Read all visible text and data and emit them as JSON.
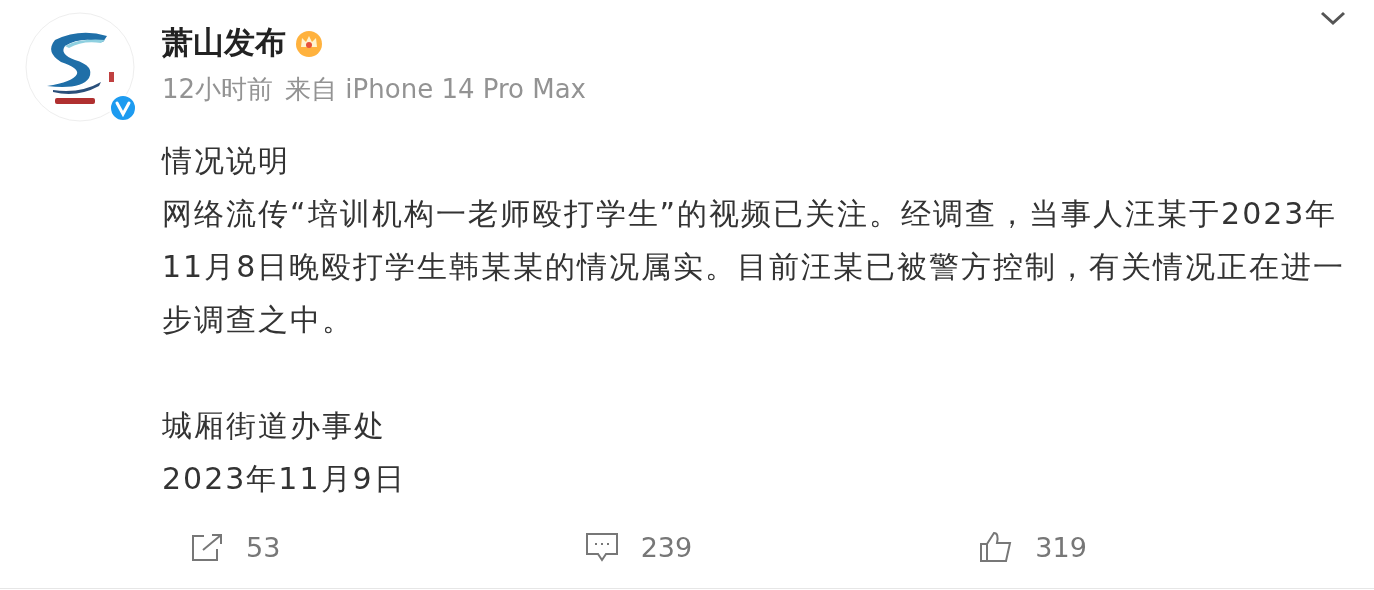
{
  "post": {
    "author": "萧山发布",
    "verified": true,
    "time": "12小时前",
    "source": "来自 iPhone 14 Pro Max",
    "paragraphs": [
      "情况说明",
      "网络流传“培训机构一老师殴打学生”的视频已关注。经调查，当事人汪某于2023年11月8日晚殴打学生韩某某的情况属实。目前汪某已被警方控制，有关情况正在进一步调查之中。"
    ],
    "signature": [
      "城厢街道办事处",
      "2023年11月9日"
    ]
  },
  "actions": [
    {
      "kind": "share",
      "count": "53"
    },
    {
      "kind": "comment",
      "count": "239"
    },
    {
      "kind": "like",
      "count": "319"
    }
  ]
}
